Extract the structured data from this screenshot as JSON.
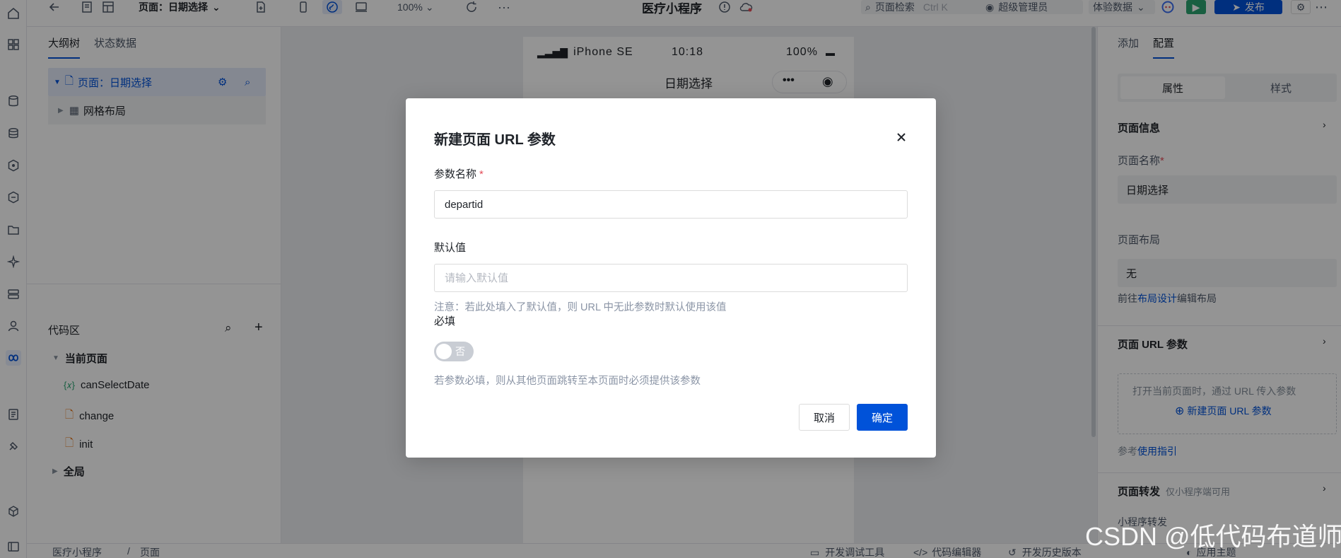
{
  "toolbar": {
    "page_label": "页面：日期选择",
    "zoom": "100%",
    "app_title": "医疗小程序",
    "search_placeholder": "页面检索",
    "search_shortcut": "Ctrl K",
    "admin": "超级管理员",
    "data_mode": "体验数据",
    "publish": "发布"
  },
  "left_panel": {
    "tab_outline": "大纲树",
    "tab_state": "状态数据",
    "tree_page": "页面：日期选择",
    "tree_grid": "网格布局",
    "code_area": "代码区",
    "current_page": "当前页面",
    "items": [
      "canSelectDate",
      "change",
      "init"
    ],
    "var_symbol": "{𝑥}",
    "global": "全局"
  },
  "phone": {
    "carrier": "iPhone SE",
    "time": "10:18",
    "battery": "100%",
    "nav_title": "日期选择"
  },
  "right_panel": {
    "tab_add": "添加",
    "tab_config": "配置",
    "seg_props": "属性",
    "seg_style": "样式",
    "page_info": "页面信息",
    "page_name_label": "页面名称",
    "page_name_value": "日期选择",
    "layout_label": "页面布局",
    "layout_value": "无",
    "layout_hint_prefix": "前往",
    "layout_hint_link": "布局设计",
    "layout_hint_suffix": "编辑布局",
    "url_params": "页面 URL 参数",
    "url_params_desc": "打开当前页面时，通过 URL 传入参数",
    "new_param": "新建页面 URL 参数",
    "ref_prefix": "参考",
    "ref_link": "使用指引",
    "forward_title": "页面转发",
    "forward_note": "仅小程序端可用",
    "mini_forward": "小程序转发"
  },
  "bottom": {
    "breadcrumb_app": "医疗小程序",
    "breadcrumb_page": "页面",
    "debug": "开发调试工具",
    "code_editor": "代码编辑器",
    "history": "开发历史版本",
    "theme": "应用主题"
  },
  "modal": {
    "title": "新建页面 URL 参数",
    "name_label": "参数名称",
    "name_value": "departid",
    "default_label": "默认值",
    "default_placeholder": "请输入默认值",
    "default_hint": "注意：若此处填入了默认值，则 URL 中无此参数时默认使用该值",
    "required_label": "必填",
    "toggle_text": "否",
    "required_hint": "若参数必填，则从其他页面跳转至本页面时必须提供该参数",
    "cancel": "取消",
    "confirm": "确定"
  },
  "watermark": "CSDN @低代码布道师",
  "colors": {
    "primary": "#0052d9",
    "required": "#e34d59",
    "publish_green": "#2ba471"
  }
}
